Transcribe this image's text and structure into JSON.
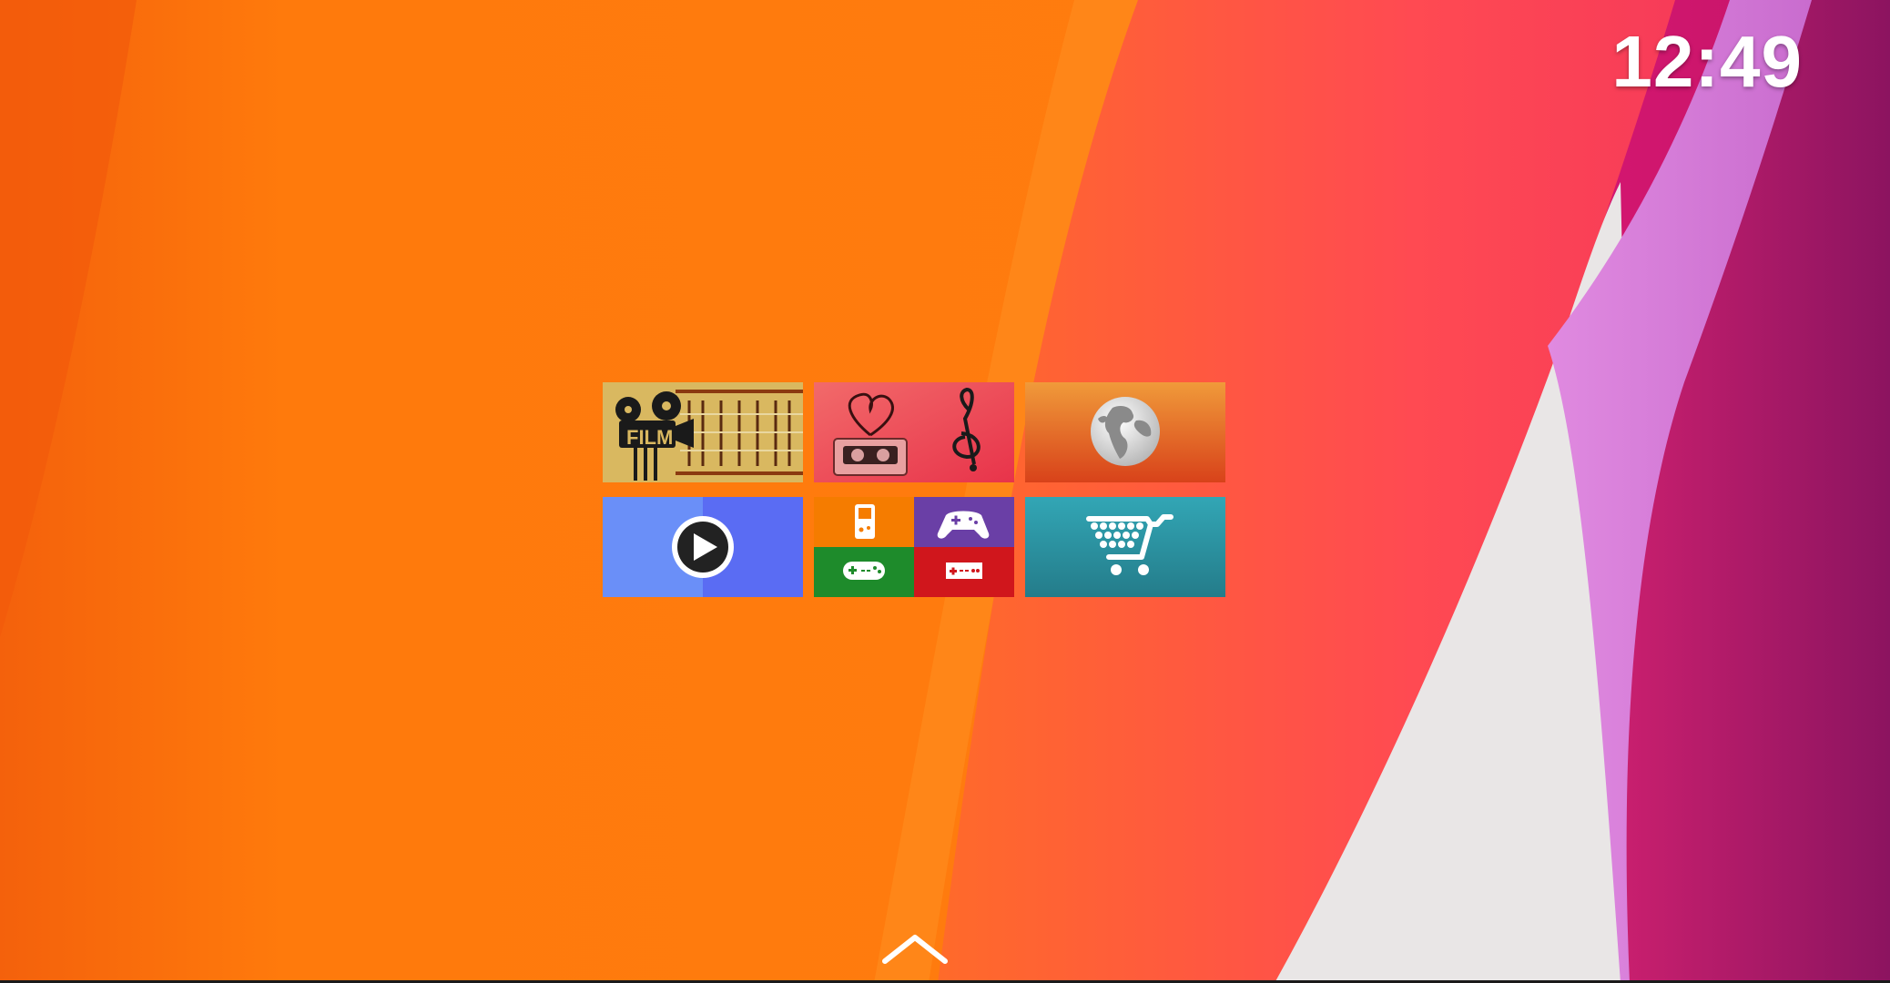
{
  "status": {
    "clock": "12:49"
  },
  "colors": {
    "wallpaper_orange": "#ff7a0c",
    "wallpaper_pink": "#ff3f5c",
    "wallpaper_magenta": "#c2186e",
    "video_tile": "#5f7cf5",
    "games_orange": "#f57c00",
    "games_purple": "#6a3fa6",
    "games_green": "#1e8b2b",
    "games_red": "#d0161c",
    "store_tile": "#2a8fa0"
  },
  "tiles": [
    {
      "id": "film",
      "icon": "film-camera-icon",
      "text": "FILM"
    },
    {
      "id": "music",
      "icon": "cassette-heart-icon"
    },
    {
      "id": "browser",
      "icon": "globe-icon"
    },
    {
      "id": "video",
      "icon": "play-icon"
    },
    {
      "id": "games",
      "icon": "gamepad-icon"
    },
    {
      "id": "store",
      "icon": "shopping-cart-icon"
    }
  ],
  "drawer": {
    "icon": "chevron-up-icon"
  }
}
